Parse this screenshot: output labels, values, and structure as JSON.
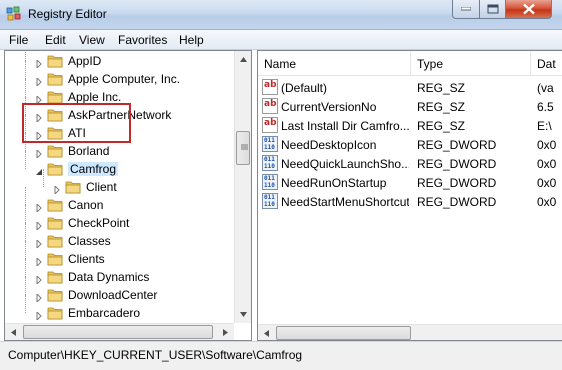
{
  "window": {
    "title": "Registry Editor"
  },
  "menu": [
    "File",
    "Edit",
    "View",
    "Favorites",
    "Help"
  ],
  "tree": {
    "items": [
      {
        "label": "AppID",
        "expandable": true
      },
      {
        "label": "Apple Computer, Inc.",
        "expandable": true
      },
      {
        "label": "Apple Inc.",
        "expandable": true
      },
      {
        "label": "AskPartnerNetwork",
        "expandable": true
      },
      {
        "label": "ATI",
        "expandable": true
      },
      {
        "label": "Borland",
        "expandable": true
      },
      {
        "label": "Camfrog",
        "expandable": true,
        "expanded": true,
        "selected": true
      },
      {
        "label": "Client",
        "expandable": true,
        "child": true
      },
      {
        "label": "Canon",
        "expandable": true
      },
      {
        "label": "CheckPoint",
        "expandable": true
      },
      {
        "label": "Classes",
        "expandable": true
      },
      {
        "label": "Clients",
        "expandable": true
      },
      {
        "label": "Data Dynamics",
        "expandable": true
      },
      {
        "label": "DownloadCenter",
        "expandable": true
      },
      {
        "label": "Embarcadero",
        "expandable": true
      }
    ]
  },
  "values": {
    "columns": [
      "Name",
      "Type",
      "Dat"
    ],
    "rows": [
      {
        "icon": "string-value-icon",
        "name": "(Default)",
        "type": "REG_SZ",
        "data": "(va"
      },
      {
        "icon": "string-value-icon",
        "name": "CurrentVersionNo",
        "type": "REG_SZ",
        "data": "6.5"
      },
      {
        "icon": "string-value-icon",
        "name": "Last Install Dir Camfro...",
        "type": "REG_SZ",
        "data": "E:\\"
      },
      {
        "icon": "dword-value-icon",
        "name": "NeedDesktopIcon",
        "type": "REG_DWORD",
        "data": "0x0"
      },
      {
        "icon": "dword-value-icon",
        "name": "NeedQuickLaunchSho...",
        "type": "REG_DWORD",
        "data": "0x0"
      },
      {
        "icon": "dword-value-icon",
        "name": "NeedRunOnStartup",
        "type": "REG_DWORD",
        "data": "0x0"
      },
      {
        "icon": "dword-value-icon",
        "name": "NeedStartMenuShortcut",
        "type": "REG_DWORD",
        "data": "0x0"
      }
    ]
  },
  "status": {
    "path": "Computer\\HKEY_CURRENT_USER\\Software\\Camfrog"
  },
  "colors": {
    "highlight": "#c0282a",
    "selection": "#cde8ff",
    "folder": "#e8c35a"
  }
}
